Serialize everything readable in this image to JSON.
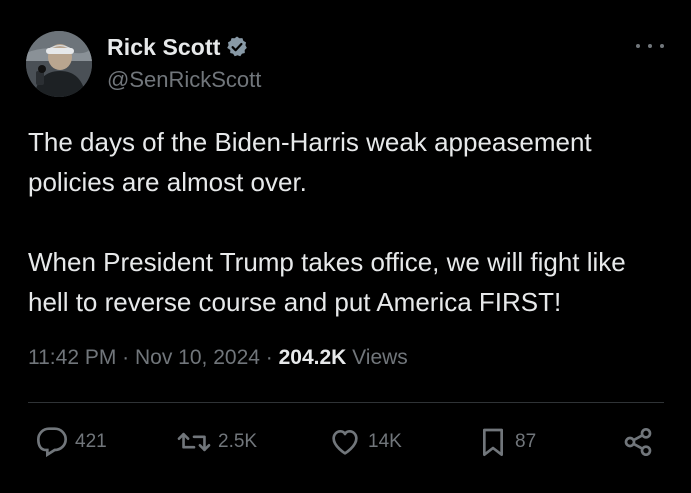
{
  "author": {
    "display_name": "Rick Scott",
    "handle": "@SenRickScott",
    "verified_color": "#8899a6"
  },
  "tweet": {
    "paragraphs": [
      "The days of the Biden-Harris weak appeasement policies are almost over.",
      "When President Trump takes office, we will fight like hell to reverse course and put America FIRST!"
    ]
  },
  "meta": {
    "time": "11:42 PM",
    "separator1": " · ",
    "date": "Nov 10, 2024",
    "separator2": " · ",
    "views_count": "204.2K",
    "views_label": " Views"
  },
  "actions": {
    "replies": "421",
    "retweets": "2.5K",
    "likes": "14K",
    "bookmarks": "87"
  },
  "icons": {
    "reply": "reply-icon",
    "retweet": "retweet-icon",
    "like": "heart-icon",
    "bookmark": "bookmark-icon",
    "share": "share-icon",
    "more": "more-icon",
    "verified": "verified-badge-icon"
  },
  "colors": {
    "background": "#000000",
    "text": "#e7e9ea",
    "muted": "#71767b",
    "divider": "#2f3336"
  }
}
